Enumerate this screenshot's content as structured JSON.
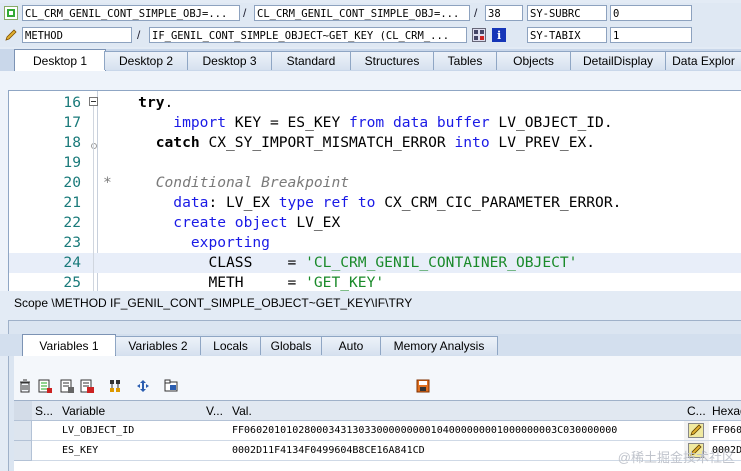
{
  "header": {
    "row1": {
      "program": "CL_CRM_GENIL_CONT_SIMPLE_OBJ=...",
      "include": "CL_CRM_GENIL_CONT_SIMPLE_OBJ=...",
      "line": "38",
      "sysvar": "SY-SUBRC",
      "sysval": "0",
      "sep": "/"
    },
    "row2": {
      "event_type": "METHOD",
      "event": "IF_GENIL_CONT_SIMPLE_OBJECT~GET_KEY (CL_CRM_...",
      "sysvar": "SY-TABIX",
      "sysval": "1",
      "sep": "/"
    }
  },
  "tabs": [
    "Desktop 1",
    "Desktop 2",
    "Desktop 3",
    "Standard",
    "Structures",
    "Tables",
    "Objects",
    "DetailDisplay",
    "Data Explor"
  ],
  "code": [
    {
      "n": "16",
      "parts": [
        {
          "t": "try",
          "c": "kwb"
        },
        {
          "t": ".",
          "c": "plain"
        }
      ],
      "indent": "    "
    },
    {
      "n": "17",
      "parts": [
        {
          "t": "import",
          "c": "kw"
        },
        {
          "t": " KEY = ES_KEY ",
          "c": "plain"
        },
        {
          "t": "from data buffer",
          "c": "kw"
        },
        {
          "t": " LV_OBJECT_ID.",
          "c": "plain"
        }
      ],
      "indent": "        "
    },
    {
      "n": "18",
      "parts": [
        {
          "t": "catch",
          "c": "kwb"
        },
        {
          "t": " CX_SY_IMPORT_MISMATCH_ERROR ",
          "c": "plain"
        },
        {
          "t": "into",
          "c": "kw"
        },
        {
          "t": " LV_PREV_EX.",
          "c": "plain"
        }
      ],
      "indent": "      "
    },
    {
      "n": "19",
      "parts": [],
      "indent": ""
    },
    {
      "n": "20",
      "parts": [
        {
          "t": "*     Conditional Breakpoint",
          "c": "cmt"
        }
      ],
      "indent": ""
    },
    {
      "n": "21",
      "parts": [
        {
          "t": "data",
          "c": "kw"
        },
        {
          "t": ": LV_EX ",
          "c": "plain"
        },
        {
          "t": "type ref to",
          "c": "kw"
        },
        {
          "t": " CX_CRM_CIC_PARAMETER_ERROR.",
          "c": "plain"
        }
      ],
      "indent": "        "
    },
    {
      "n": "22",
      "parts": [
        {
          "t": "create object",
          "c": "kw"
        },
        {
          "t": " LV_EX",
          "c": "plain"
        }
      ],
      "indent": "        "
    },
    {
      "n": "23",
      "parts": [
        {
          "t": "exporting",
          "c": "kw"
        }
      ],
      "indent": "          "
    },
    {
      "n": "24",
      "parts": [
        {
          "t": "CLASS    = ",
          "c": "plain"
        },
        {
          "t": "'CL_CRM_GENIL_CONTAINER_OBJECT'",
          "c": "str"
        }
      ],
      "indent": "            "
    },
    {
      "n": "25",
      "parts": [
        {
          "t": "METH     = ",
          "c": "plain"
        },
        {
          "t": "'GET_KEY'",
          "c": "str"
        }
      ],
      "indent": "            "
    }
  ],
  "scope_text": "Scope \\METHOD IF_GENIL_CONT_SIMPLE_OBJECT~GET_KEY\\IF\\TRY",
  "lower_tabs": [
    "Variables 1",
    "Variables 2",
    "Locals",
    "Globals",
    "Auto",
    "Memory Analysis"
  ],
  "table": {
    "headers": [
      "S...",
      "Variable",
      "V...",
      "Val.",
      "C...",
      "Hexade"
    ],
    "rows": [
      {
        "variable": "LV_OBJECT_ID",
        "value": "FF0602010102800034313033000000000104000000001000000003C030000000",
        "hex": "FF060"
      },
      {
        "variable": "ES_KEY",
        "value": "0002D11F4134F0499604B8CE16A841CD",
        "hex": "0002D"
      }
    ]
  },
  "watermark": "@稀土掘金技术社区"
}
